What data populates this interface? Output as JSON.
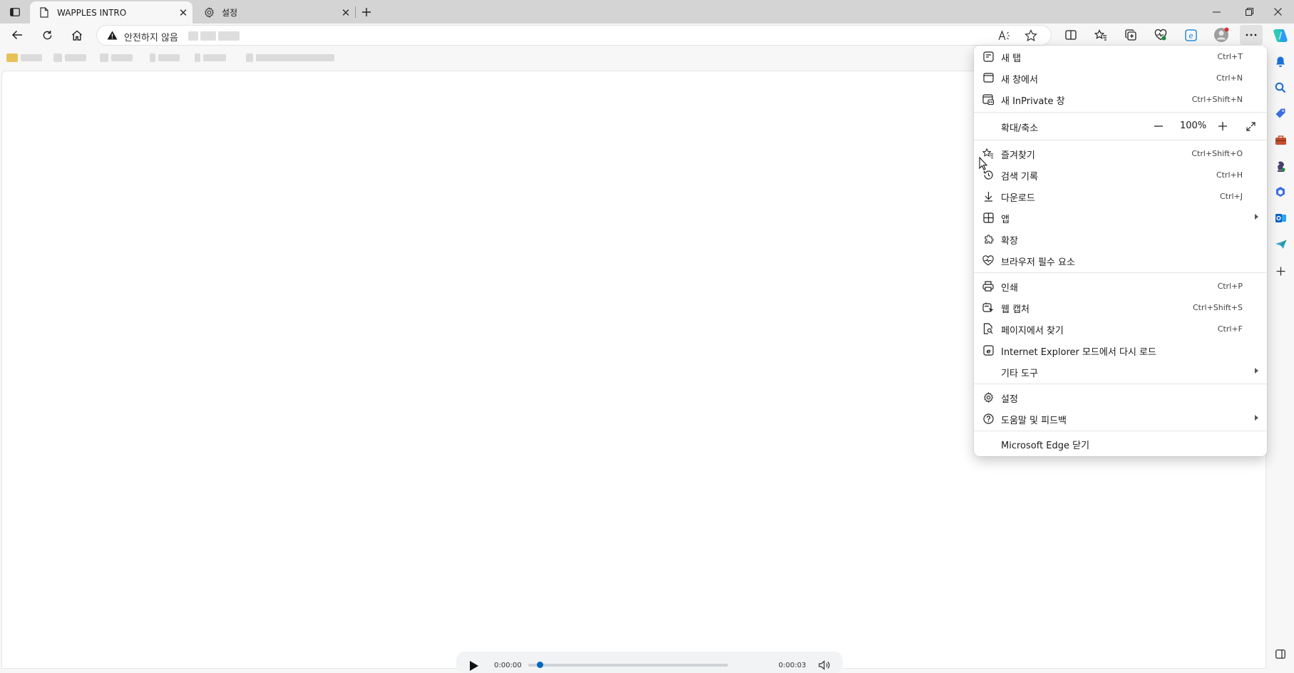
{
  "tabs": [
    {
      "label": "WAPPLES INTRO",
      "icon": "page-icon"
    },
    {
      "label": "설정",
      "icon": "gear-icon"
    }
  ],
  "tab_close_glyph": "✕",
  "address": {
    "security_label": "안전하지 않음"
  },
  "menu": {
    "groups": [
      [
        {
          "label": "새 탭",
          "shortcut": "Ctrl+T",
          "icon": "new-tab-icon"
        },
        {
          "label": "새 창에서",
          "shortcut": "Ctrl+N",
          "icon": "new-window-icon"
        },
        {
          "label": "새 InPrivate 창",
          "shortcut": "Ctrl+Shift+N",
          "icon": "inprivate-icon"
        }
      ],
      [
        {
          "label": "즐겨찾기",
          "shortcut": "Ctrl+Shift+O",
          "icon": "favorites-icon"
        },
        {
          "label": "검색 기록",
          "shortcut": "Ctrl+H",
          "icon": "history-icon"
        },
        {
          "label": "다운로드",
          "shortcut": "Ctrl+J",
          "icon": "download-icon"
        },
        {
          "label": "앱",
          "shortcut": "",
          "icon": "apps-icon",
          "submenu": true
        },
        {
          "label": "확장",
          "shortcut": "",
          "icon": "extensions-icon"
        },
        {
          "label": "브라우저 필수 요소",
          "shortcut": "",
          "icon": "essentials-icon"
        }
      ],
      [
        {
          "label": "인쇄",
          "shortcut": "Ctrl+P",
          "icon": "print-icon"
        },
        {
          "label": "웹 캡처",
          "shortcut": "Ctrl+Shift+S",
          "icon": "web-capture-icon"
        },
        {
          "label": "페이지에서 찾기",
          "shortcut": "Ctrl+F",
          "icon": "find-icon"
        },
        {
          "label": "Internet Explorer 모드에서 다시 로드",
          "shortcut": "",
          "icon": "ie-mode-icon"
        },
        {
          "label": "기타 도구",
          "shortcut": "",
          "icon": "",
          "submenu": true
        }
      ],
      [
        {
          "label": "설정",
          "shortcut": "",
          "icon": "settings-icon"
        },
        {
          "label": "도움말 및 피드백",
          "shortcut": "",
          "icon": "help-icon",
          "submenu": true
        }
      ],
      [
        {
          "label": "Microsoft Edge 닫기",
          "shortcut": "",
          "icon": ""
        }
      ]
    ],
    "zoom": {
      "label": "확대/축소",
      "value": "100%",
      "minus": "—",
      "plus": "+"
    }
  },
  "player": {
    "current": "0:00:00",
    "total": "0:00:03"
  },
  "colors": {
    "accent": "#0067c0",
    "warning": "#1b1b1b"
  }
}
